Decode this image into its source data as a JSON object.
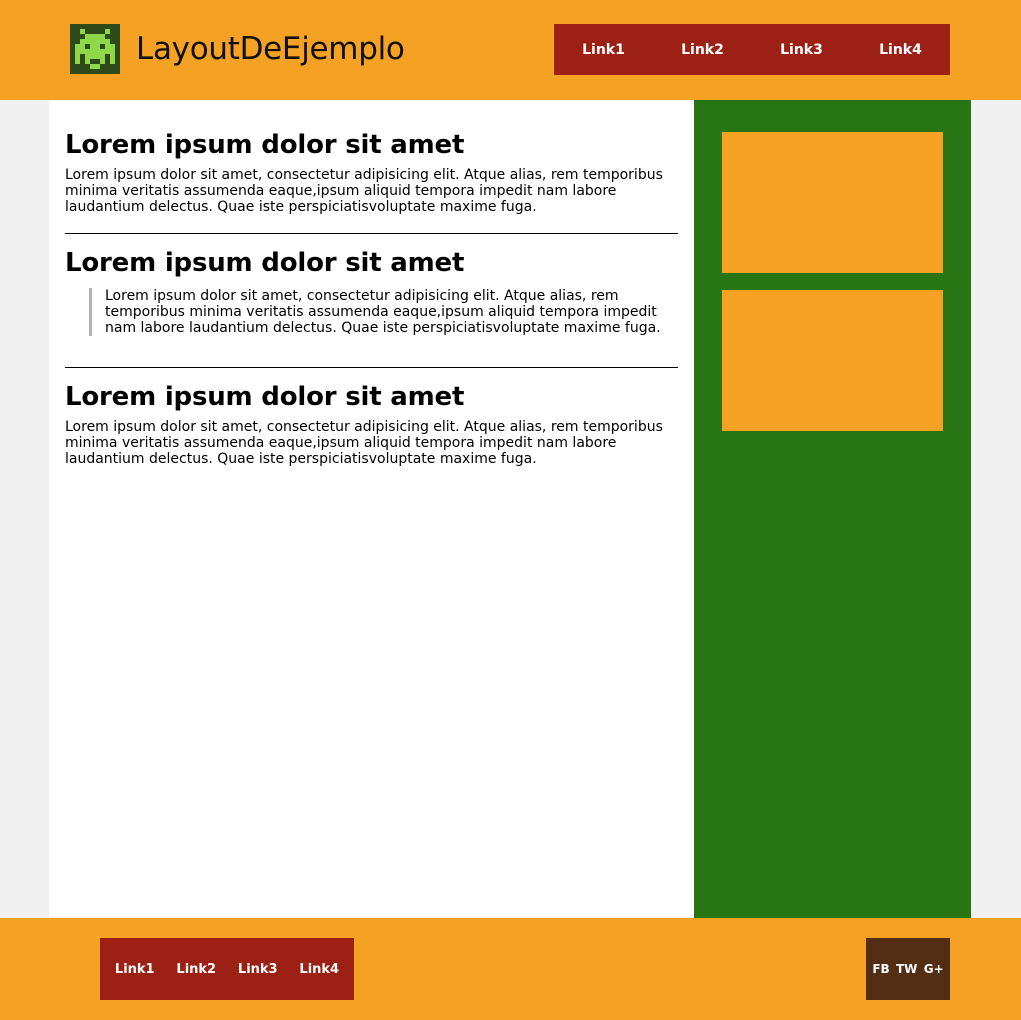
{
  "header": {
    "site_title": "LayoutDeEjemplo",
    "logo_icon": "space-invader-icon",
    "nav": [
      "Link1",
      "Link2",
      "Link3",
      "Link4"
    ]
  },
  "main": {
    "articles": [
      {
        "title": "Lorem ipsum dolor sit amet",
        "body": "Lorem ipsum dolor sit amet, consectetur adipisicing elit. Atque alias, rem temporibus minima veritatis assumenda eaque,ipsum aliquid tempora impedit nam labore laudantium delectus. Quae iste perspiciatisvoluptate maxime fuga."
      },
      {
        "title": "Lorem ipsum dolor sit amet",
        "quote": "Lorem ipsum dolor sit amet, consectetur adipisicing elit. Atque alias, rem temporibus minima veritatis assumenda eaque,ipsum aliquid tempora impedit nam labore laudantium delectus. Quae iste perspiciatisvoluptate maxime fuga."
      },
      {
        "title": "Lorem ipsum dolor sit amet",
        "body": "Lorem ipsum dolor sit amet, consectetur adipisicing elit. Atque alias, rem temporibus minima veritatis assumenda eaque,ipsum aliquid tempora impedit nam labore laudantium delectus. Quae iste perspiciatisvoluptate maxime fuga."
      }
    ]
  },
  "footer": {
    "nav": [
      "Link1",
      "Link2",
      "Link3",
      "Link4"
    ],
    "social": [
      "FB",
      "TW",
      "G+"
    ]
  },
  "colors": {
    "header_footer": "#f5a224",
    "nav_bg": "#9c2014",
    "sidebar": "#287613",
    "social_bg": "#532e15"
  }
}
